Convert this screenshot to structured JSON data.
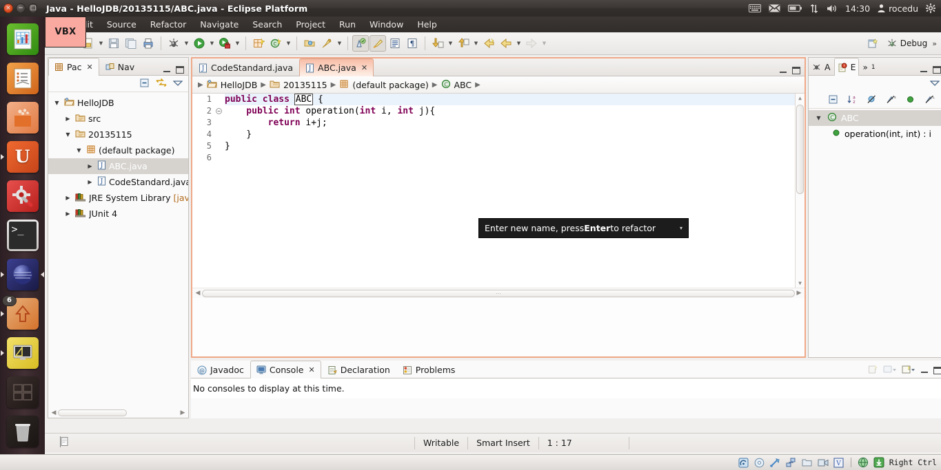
{
  "window": {
    "title": "Java - HelloJDB/20135115/ABC.java - Eclipse Platform"
  },
  "top_panel": {
    "clock": "14:30",
    "user": "rocedu",
    "icons": [
      "keyboard-icon",
      "mail-icon",
      "battery-icon",
      "network-icon",
      "volume-icon",
      "gear-icon"
    ]
  },
  "launcher": {
    "items": [
      {
        "name": "libreoffice-calc",
        "badge": ""
      },
      {
        "name": "libreoffice-impress",
        "badge": ""
      },
      {
        "name": "ubuntu-software-center",
        "badge": ""
      },
      {
        "name": "ubuntu-one",
        "badge": ""
      },
      {
        "name": "system-settings",
        "badge": ""
      },
      {
        "name": "terminal",
        "badge": ""
      },
      {
        "name": "eclipse",
        "badge": ""
      },
      {
        "name": "update-manager",
        "badge": "6"
      },
      {
        "name": "display-settings",
        "badge": ""
      },
      {
        "name": "workspace-switcher",
        "badge": ""
      },
      {
        "name": "trash",
        "badge": ""
      }
    ]
  },
  "vbx_overlay": {
    "label": "VBX"
  },
  "menubar": {
    "items": [
      "lit",
      "Source",
      "Refactor",
      "Navigate",
      "Search",
      "Project",
      "Run",
      "Window",
      "Help"
    ]
  },
  "toolbar": {
    "perspective_label": "Debug",
    "overflow": "»"
  },
  "package_explorer": {
    "tabs": [
      {
        "label": "Pac",
        "icon": "package-explorer-icon",
        "selected": true,
        "closable": true
      },
      {
        "label": "Nav",
        "icon": "navigator-icon",
        "selected": false,
        "closable": false
      }
    ],
    "tree": [
      {
        "label": "HelloJDB",
        "indent": 0,
        "twisty": "open",
        "icon": "java-project-icon",
        "selected": false,
        "suffix": ""
      },
      {
        "label": "src",
        "indent": 1,
        "twisty": "closed",
        "icon": "source-folder-icon",
        "selected": false,
        "suffix": ""
      },
      {
        "label": "20135115",
        "indent": 1,
        "twisty": "open",
        "icon": "source-folder-icon",
        "selected": false,
        "suffix": ""
      },
      {
        "label": "(default package)",
        "indent": 2,
        "twisty": "open",
        "icon": "package-icon",
        "selected": false,
        "suffix": ""
      },
      {
        "label": "ABC.java",
        "indent": 3,
        "twisty": "closed",
        "icon": "java-file-icon",
        "selected": true,
        "suffix": ""
      },
      {
        "label": "CodeStandard.java",
        "indent": 3,
        "twisty": "closed",
        "icon": "java-file-icon",
        "selected": false,
        "suffix": ""
      },
      {
        "label": "JRE System Library ",
        "indent": 1,
        "twisty": "closed",
        "icon": "library-icon",
        "selected": false,
        "suffix": "[jav"
      },
      {
        "label": "JUnit 4",
        "indent": 1,
        "twisty": "closed",
        "icon": "library-icon",
        "selected": false,
        "suffix": ""
      }
    ]
  },
  "editor": {
    "tabs": [
      {
        "label": "CodeStandard.java",
        "selected": false,
        "closable": false
      },
      {
        "label": "ABC.java",
        "selected": true,
        "closable": true
      }
    ],
    "breadcrumb": [
      {
        "label": "HelloJDB",
        "icon": "java-project-icon"
      },
      {
        "label": "20135115",
        "icon": "source-folder-icon"
      },
      {
        "label": "(default package)",
        "icon": "package-icon"
      },
      {
        "label": "ABC",
        "icon": "class-icon"
      }
    ],
    "line_numbers": [
      "1",
      "2",
      "3",
      "4",
      "5",
      "6"
    ],
    "code_lines": [
      {
        "num": "1",
        "segments": [
          {
            "t": "public class ",
            "k": true
          },
          {
            "t": "ABC",
            "k": false,
            "sel": true
          },
          {
            "t": " {",
            "k": false
          }
        ],
        "highlight": true,
        "fold": false
      },
      {
        "num": "2",
        "segments": [
          {
            "t": "    public ",
            "k": true
          },
          {
            "t": "int",
            "k": true
          },
          {
            "t": " operation(",
            "k": false
          },
          {
            "t": "int",
            "k": true
          },
          {
            "t": " i, ",
            "k": false
          },
          {
            "t": "int",
            "k": true
          },
          {
            "t": " j){",
            "k": false
          }
        ],
        "highlight": false,
        "fold": true
      },
      {
        "num": "3",
        "segments": [
          {
            "t": "        return",
            "k": true
          },
          {
            "t": " i+j;",
            "k": false
          }
        ],
        "highlight": false,
        "fold": false
      },
      {
        "num": "4",
        "segments": [
          {
            "t": "    }",
            "k": false
          }
        ],
        "highlight": false,
        "fold": false
      },
      {
        "num": "5",
        "segments": [
          {
            "t": "}",
            "k": false
          }
        ],
        "highlight": false,
        "fold": false
      },
      {
        "num": "6",
        "segments": [
          {
            "t": "",
            "k": false
          }
        ],
        "highlight": false,
        "fold": false
      }
    ],
    "refactor_tip": {
      "prefix": "Enter new name, press ",
      "bold": "Enter",
      "suffix": " to refactor",
      "caret": "▾"
    }
  },
  "outline": {
    "tabs": [
      {
        "label": "A",
        "icon": "junit-icon",
        "selected": false
      },
      {
        "label": "E",
        "icon": "error-log-icon",
        "selected": true
      },
      {
        "label": "»",
        "icon": "overflow-icon",
        "selected": false,
        "count": "1"
      }
    ],
    "rows": [
      {
        "label": "ABC",
        "indent": 0,
        "twisty": "open",
        "icon": "class-icon",
        "selected": true
      },
      {
        "label": "operation(int, int) : i",
        "indent": 1,
        "twisty": "none",
        "icon": "method-public-icon",
        "selected": false
      }
    ]
  },
  "bottom_panel": {
    "tabs": [
      {
        "label": "Javadoc",
        "icon": "javadoc-icon",
        "selected": false,
        "closable": false
      },
      {
        "label": "Console",
        "icon": "console-icon",
        "selected": true,
        "closable": true
      },
      {
        "label": "Declaration",
        "icon": "declaration-icon",
        "selected": false,
        "closable": false
      },
      {
        "label": "Problems",
        "icon": "problems-icon",
        "selected": false,
        "closable": false
      }
    ],
    "content": "No consoles to display at this time."
  },
  "statusbar": {
    "writable": "Writable",
    "insert_mode": "Smart Insert",
    "position": "1 : 17"
  },
  "vbox_statusbar": {
    "icons": [
      "hdd-icon",
      "cd-icon",
      "usb-icon",
      "network-icon",
      "shared-folder-icon",
      "video-icon",
      "vbox-icon",
      "globe-icon",
      "download-icon"
    ],
    "host_key": "Right Ctrl"
  },
  "colors": {
    "accent_orange": "#f0a080",
    "keyword": "#7f0055",
    "selection_gray": "#d6d3cf",
    "panel_bg": "#fbfafa",
    "tooltip_bg": "#1c1c1c"
  }
}
